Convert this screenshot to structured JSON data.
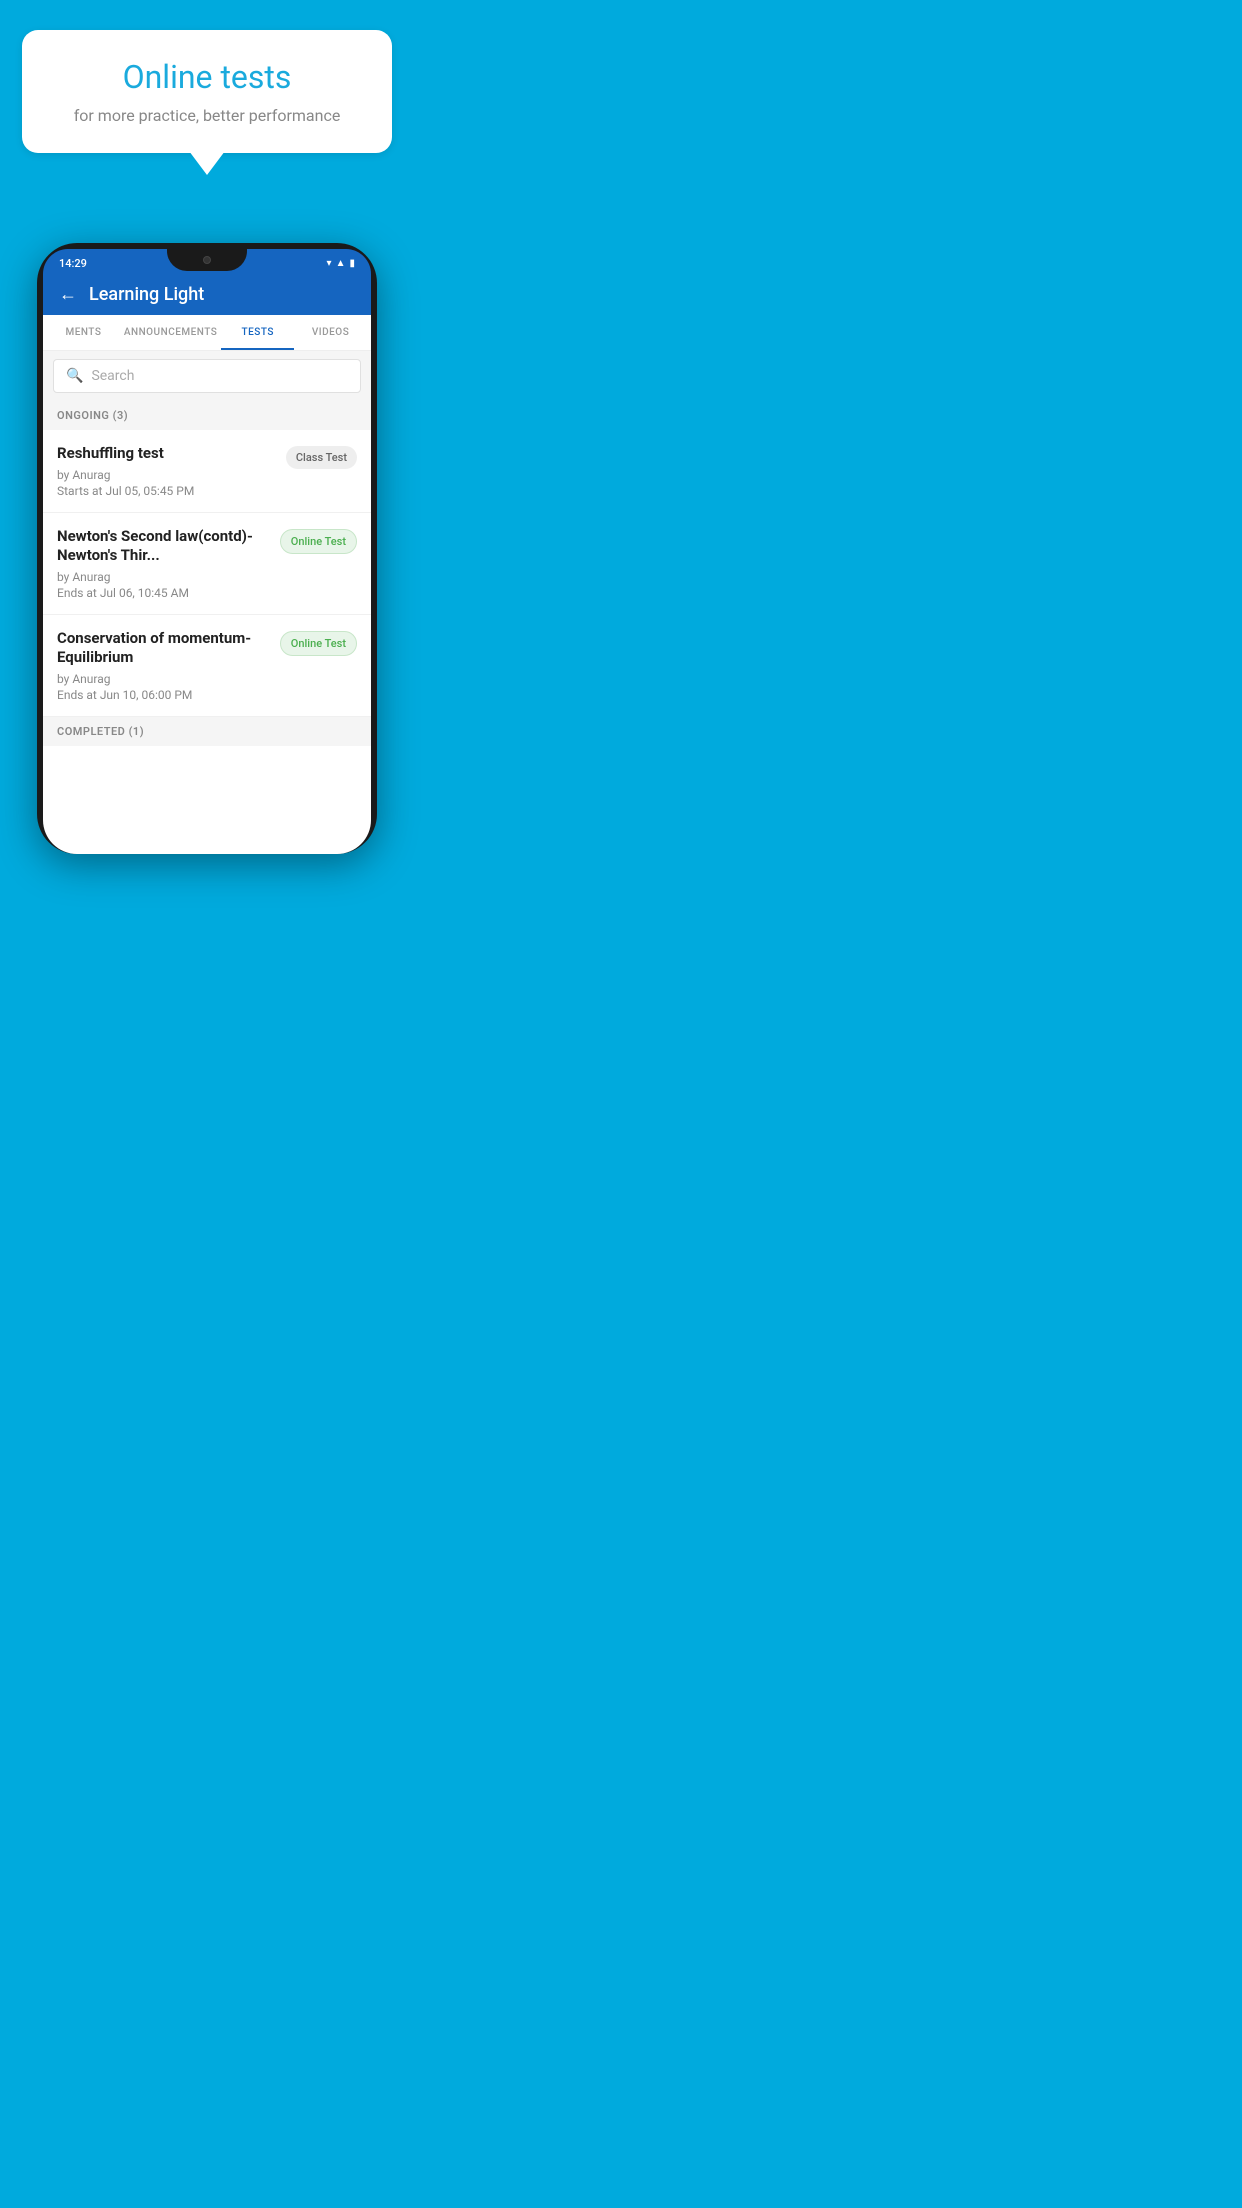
{
  "background_color": "#00AADD",
  "hero": {
    "bubble_title": "Online tests",
    "bubble_subtitle": "for more practice, better performance"
  },
  "phone": {
    "status_bar": {
      "time": "14:29"
    },
    "header": {
      "back_label": "←",
      "title": "Learning Light"
    },
    "tabs": [
      {
        "label": "MENTS",
        "active": false
      },
      {
        "label": "ANNOUNCEMENTS",
        "active": false
      },
      {
        "label": "TESTS",
        "active": true
      },
      {
        "label": "VIDEOS",
        "active": false
      }
    ],
    "search": {
      "placeholder": "Search"
    },
    "ongoing_section": {
      "label": "ONGOING (3)",
      "tests": [
        {
          "name": "Reshuffling test",
          "by": "by Anurag",
          "date": "Starts at  Jul 05, 05:45 PM",
          "badge": "Class Test",
          "badge_type": "class"
        },
        {
          "name": "Newton's Second law(contd)-Newton's Thir...",
          "by": "by Anurag",
          "date": "Ends at  Jul 06, 10:45 AM",
          "badge": "Online Test",
          "badge_type": "online"
        },
        {
          "name": "Conservation of momentum-Equilibrium",
          "by": "by Anurag",
          "date": "Ends at  Jun 10, 06:00 PM",
          "badge": "Online Test",
          "badge_type": "online"
        }
      ]
    },
    "completed_label": "COMPLETED (1)"
  }
}
